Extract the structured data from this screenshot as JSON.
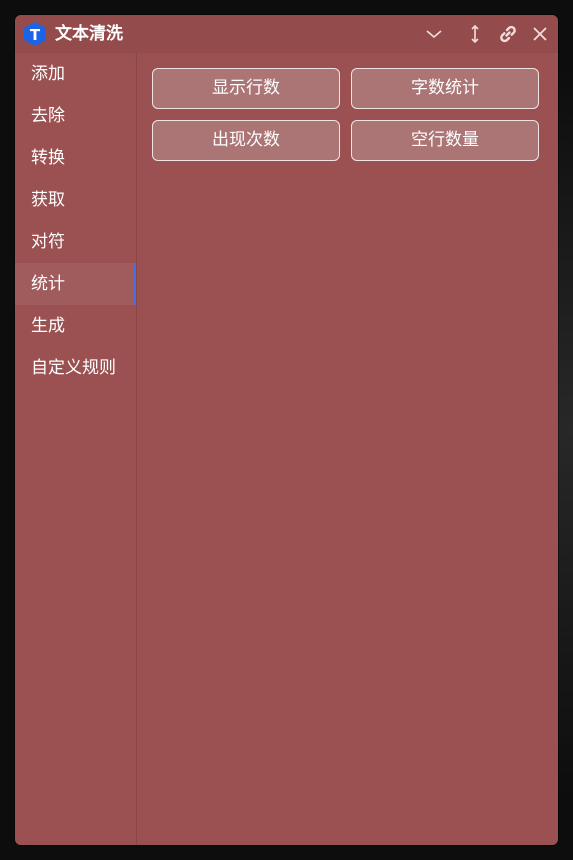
{
  "app": {
    "title": "文本清洗",
    "logo_letter": "T"
  },
  "titlebar_icons": [
    "chevron-down-icon",
    "resize-vertical-icon",
    "link-icon",
    "close-icon"
  ],
  "sidebar": {
    "items": [
      {
        "label": "添加",
        "active": false
      },
      {
        "label": "去除",
        "active": false
      },
      {
        "label": "转换",
        "active": false
      },
      {
        "label": "获取",
        "active": false
      },
      {
        "label": "对符",
        "active": false
      },
      {
        "label": "统计",
        "active": true
      },
      {
        "label": "生成",
        "active": false
      },
      {
        "label": "自定义规则",
        "active": false
      }
    ]
  },
  "actions": {
    "buttons": [
      {
        "label": "显示行数"
      },
      {
        "label": "字数统计"
      },
      {
        "label": "出现次数"
      },
      {
        "label": "空行数量"
      }
    ]
  },
  "colors": {
    "window_bg": "#9b5151",
    "titlebar_bg": "#944b4b",
    "button_bg": "#ab7575",
    "active_indicator": "#4a6de6",
    "logo": "#1d63e6"
  }
}
